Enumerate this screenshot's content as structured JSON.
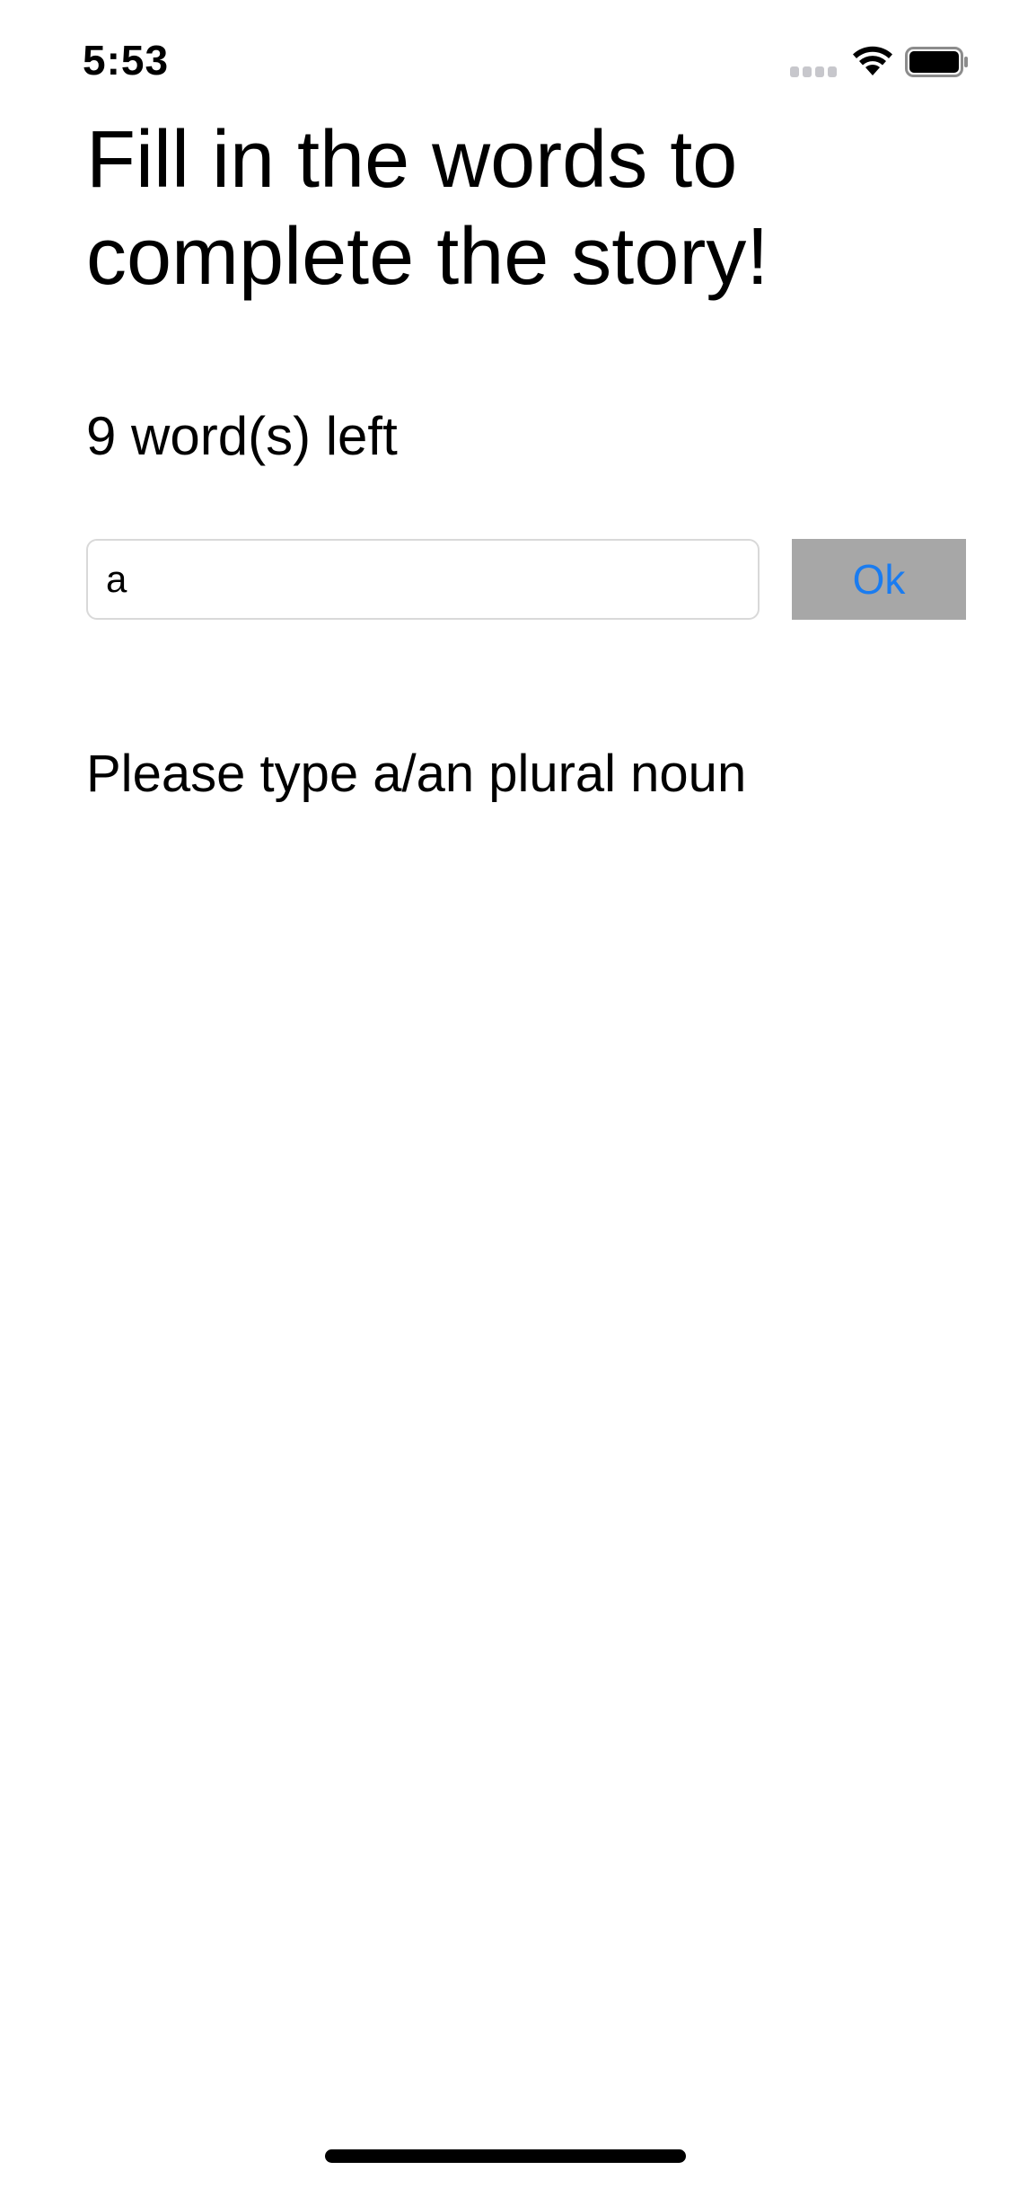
{
  "status_bar": {
    "time": "5:53",
    "icons": [
      "cellular-signal-icon",
      "wifi-icon",
      "battery-icon"
    ]
  },
  "screen": {
    "title": "Fill in the words to complete the story!",
    "words_left": "9 word(s) left",
    "input": {
      "value": "a",
      "placeholder": ""
    },
    "ok_button_label": "Ok",
    "prompt": "Please type a/an plural noun"
  },
  "colors": {
    "button_background": "#a7a7a7",
    "button_text": "#1a7cf0",
    "caret": "#5b8def",
    "text": "#000000",
    "background": "#ffffff"
  }
}
